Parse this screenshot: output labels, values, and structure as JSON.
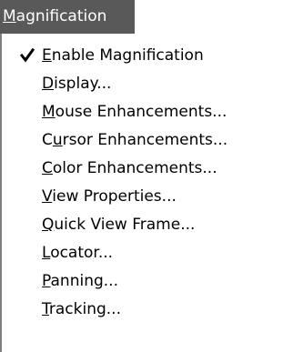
{
  "menu": {
    "title": "Magnification",
    "title_mnemonic": "M",
    "items": [
      {
        "label": "Enable Magnification",
        "mnemonic_index": 0,
        "checked": true
      },
      {
        "label": "Display...",
        "mnemonic_index": 0,
        "checked": false
      },
      {
        "label": "Mouse Enhancements...",
        "mnemonic_index": 0,
        "checked": false
      },
      {
        "label": "Cursor Enhancements...",
        "mnemonic_index": 1,
        "checked": false
      },
      {
        "label": "Color Enhancements...",
        "mnemonic_index": 0,
        "checked": false
      },
      {
        "label": "View Properties...",
        "mnemonic_index": 0,
        "checked": false
      },
      {
        "label": "Quick View Frame...",
        "mnemonic_index": 0,
        "checked": false
      },
      {
        "label": "Locator...",
        "mnemonic_index": 0,
        "checked": false
      },
      {
        "label": "Panning...",
        "mnemonic_index": 0,
        "checked": false
      },
      {
        "label": "Tracking...",
        "mnemonic_index": 0,
        "checked": false
      }
    ],
    "check_icon": "checkmark-icon",
    "colors": {
      "title_bg": "#595959",
      "title_fg": "#ffffff",
      "panel_border": "#7f7f7f",
      "text": "#000000"
    }
  }
}
